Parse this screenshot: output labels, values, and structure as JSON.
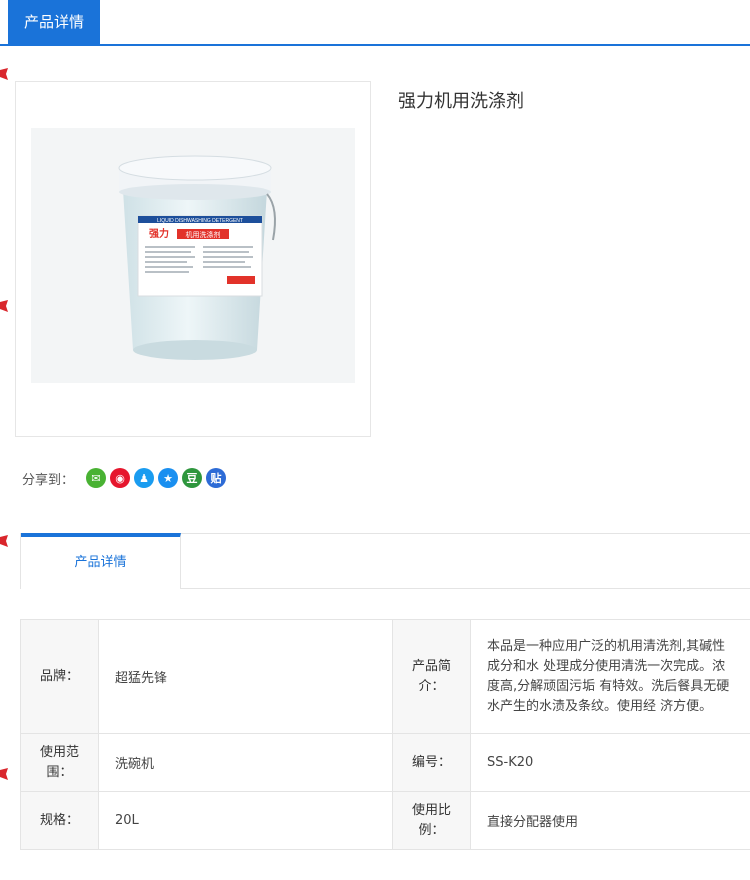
{
  "header": {
    "tab_label": "产品详情"
  },
  "product": {
    "title": "强力机用洗涤剂",
    "image": {
      "label_text": "LIQUID DISHWASHING DETERGENT",
      "brand_text": "强力",
      "name_text": "机用洗涤剂"
    }
  },
  "share": {
    "label": "分享到：",
    "icons": [
      {
        "name": "wechat-icon",
        "glyph": "✉",
        "color": "#49b233"
      },
      {
        "name": "weibo-icon",
        "glyph": "◉",
        "color": "#e6162d"
      },
      {
        "name": "qq-icon",
        "glyph": "♟",
        "color": "#1a9cf0"
      },
      {
        "name": "qzone-icon",
        "glyph": "★",
        "color": "#1a8ff0"
      },
      {
        "name": "douban-icon",
        "glyph": "豆",
        "color": "#2e963d"
      },
      {
        "name": "tieba-icon",
        "glyph": "贴",
        "color": "#2d6bd6"
      }
    ]
  },
  "detail": {
    "tab_label": "产品详情",
    "rows": [
      {
        "l1": "品牌：",
        "v1": "超猛先锋",
        "l2": "产品简介：",
        "v2": "本品是一种应用广泛的机用清洗剂,其碱性成分和水 处理成分使用清洗一次完成。浓度高,分解顽固污垢 有特效。洗后餐具无硬水产生的水渍及条纹。使用经 济方便。"
      },
      {
        "l1": "使用范围：",
        "v1": "洗碗机",
        "l2": "编号：",
        "v2": "SS-K20"
      },
      {
        "l1": "规格：",
        "v1": "20L",
        "l2": "使用比例：",
        "v2": "直接分配器使用"
      }
    ]
  }
}
